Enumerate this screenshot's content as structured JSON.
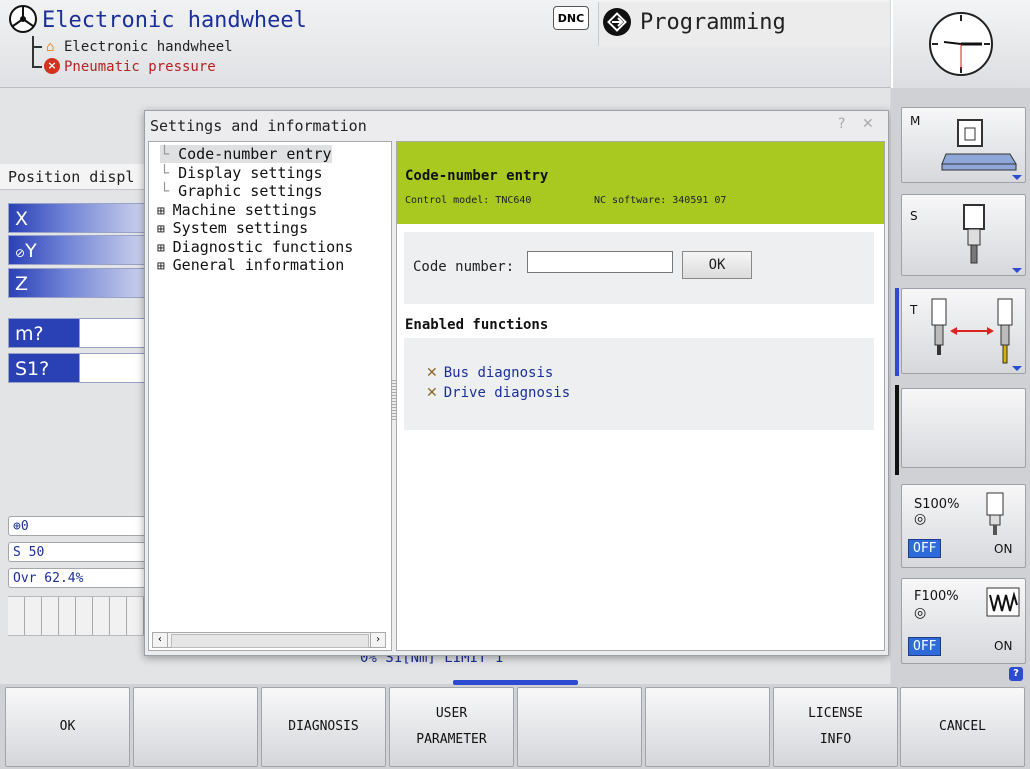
{
  "header": {
    "mode_title": "Electronic handwheel",
    "messages": [
      "Electronic handwheel",
      "Pneumatic pressure"
    ],
    "dnc_label": "DNC",
    "programming_label": "Programming"
  },
  "position_display": {
    "title": "Position displ",
    "axes": [
      "X",
      "Y",
      "Z"
    ],
    "m_label": "m?",
    "s_label": "S1?",
    "info": {
      "datum": "0",
      "spindle": "S 50",
      "override": "Ovr 62.4%"
    },
    "behind_status": "0%  S1[Nm]   LIMIT 1"
  },
  "dialog": {
    "title": "Settings and information",
    "tree": [
      {
        "label": "Code-number entry",
        "expandable": false,
        "selected": true
      },
      {
        "label": "Display settings",
        "expandable": false,
        "selected": false
      },
      {
        "label": "Graphic settings",
        "expandable": false,
        "selected": false
      },
      {
        "label": "Machine settings",
        "expandable": true,
        "selected": false
      },
      {
        "label": "System settings",
        "expandable": true,
        "selected": false
      },
      {
        "label": "Diagnostic functions",
        "expandable": true,
        "selected": false
      },
      {
        "label": "General information",
        "expandable": true,
        "selected": false
      }
    ],
    "content": {
      "title": "Code-number entry",
      "control_model": "Control model: TNC640",
      "nc_software": "NC software: 340591 07",
      "code_label": "Code number:",
      "code_value": "",
      "ok_label": "OK",
      "enabled_title": "Enabled functions",
      "functions": [
        "Bus diagnosis",
        "Drive diagnosis"
      ]
    }
  },
  "right_softkeys": {
    "m": "M",
    "s": "S",
    "t": "T",
    "s_override": {
      "label": "S100%",
      "off": "OFF",
      "on": "ON"
    },
    "f_override": {
      "label": "F100%",
      "off": "OFF",
      "on": "ON"
    }
  },
  "bottom_softkeys": [
    {
      "lines": [
        "OK"
      ]
    },
    {
      "lines": [
        ""
      ]
    },
    {
      "lines": [
        "DIAGNOSIS"
      ]
    },
    {
      "lines": [
        "USER",
        "PARAMETER"
      ]
    },
    {
      "lines": [
        ""
      ]
    },
    {
      "lines": [
        ""
      ]
    },
    {
      "lines": [
        "LICENSE",
        "INFO"
      ]
    },
    {
      "lines": [
        "CANCEL"
      ]
    }
  ],
  "colors": {
    "accent_blue": "#2c4bd0",
    "banner_green": "#a9c820",
    "error_red": "#b52222"
  }
}
